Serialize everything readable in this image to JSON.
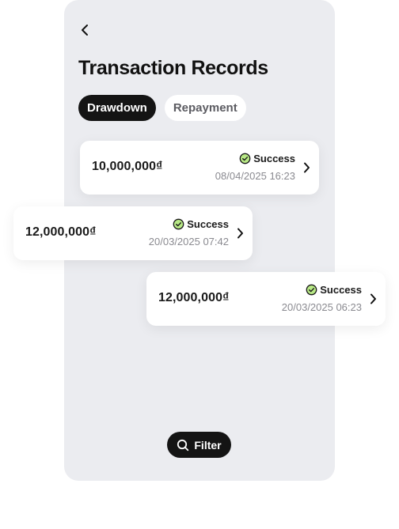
{
  "header": {
    "back_icon": "chevron-left-icon",
    "title": "Transaction Records"
  },
  "tabs": [
    {
      "label": "Drawdown",
      "active": true
    },
    {
      "label": "Repayment",
      "active": false
    }
  ],
  "records": [
    {
      "amount": "10,000,000₫",
      "status": "Success",
      "datetime": "08/04/2025 16:23"
    },
    {
      "amount": "12,000,000₫",
      "status": "Success",
      "datetime": "20/03/2025 07:42"
    },
    {
      "amount": "12,000,000₫",
      "status": "Success",
      "datetime": "20/03/2025 06:23"
    }
  ],
  "filter": {
    "label": "Filter",
    "icon": "search-icon"
  },
  "colors": {
    "screen_background": "#ebecf0",
    "dark": "#141414",
    "success_green": "#b8e986",
    "muted_text": "#8a8a90"
  }
}
